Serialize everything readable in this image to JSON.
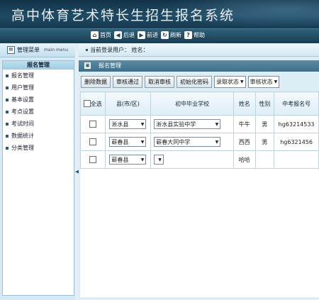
{
  "header": {
    "title": "高中体育艺术特长生招生报名系统"
  },
  "topnav": [
    {
      "icon": "home-icon",
      "glyph": "⌂",
      "label": "首页"
    },
    {
      "icon": "back-icon",
      "glyph": "◀",
      "label": "后退"
    },
    {
      "icon": "forward-icon",
      "glyph": "▶",
      "label": "前进"
    },
    {
      "icon": "refresh-icon",
      "glyph": "↻",
      "label": "刷新"
    },
    {
      "icon": "help-icon",
      "glyph": "?",
      "label": "帮助"
    }
  ],
  "sidebar": {
    "title": "管理菜单",
    "title_en": "main menu",
    "selected": "报名管理",
    "items": [
      "报名管理",
      "用户管理",
      "基本设置",
      "考点设置",
      "考试时间",
      "数据统计",
      "分类管理"
    ]
  },
  "userbar": {
    "text": "当前登录用户：  姓名："
  },
  "section": {
    "title": "报名管理"
  },
  "toolbar": {
    "buttons": [
      "删除数据",
      "审核通过",
      "取消审核",
      "初始化密码"
    ],
    "selects": [
      "录取状态",
      "审核状态"
    ]
  },
  "table": {
    "headers": [
      "全选",
      "县(市/区)",
      "初中毕业学校",
      "姓名",
      "性别",
      "中考报名号"
    ],
    "rows": [
      {
        "county": "淅水县",
        "school": "淅水县实验中学",
        "name": "牛牛",
        "gender": "男",
        "reg_no": "hg63214533"
      },
      {
        "county": "蕲春县",
        "school": "蕲春大同中学",
        "name": "西西",
        "gender": "男",
        "reg_no": "hg6321456"
      },
      {
        "county": "蕲春县",
        "school": "",
        "name": "哈哈",
        "gender": "",
        "reg_no": ""
      }
    ]
  },
  "colors": {
    "header_bg": "#173a51",
    "nav_bg": "#1f4b65",
    "panel_bg": "#dcedf6",
    "section_bar": "#4a7a93"
  }
}
